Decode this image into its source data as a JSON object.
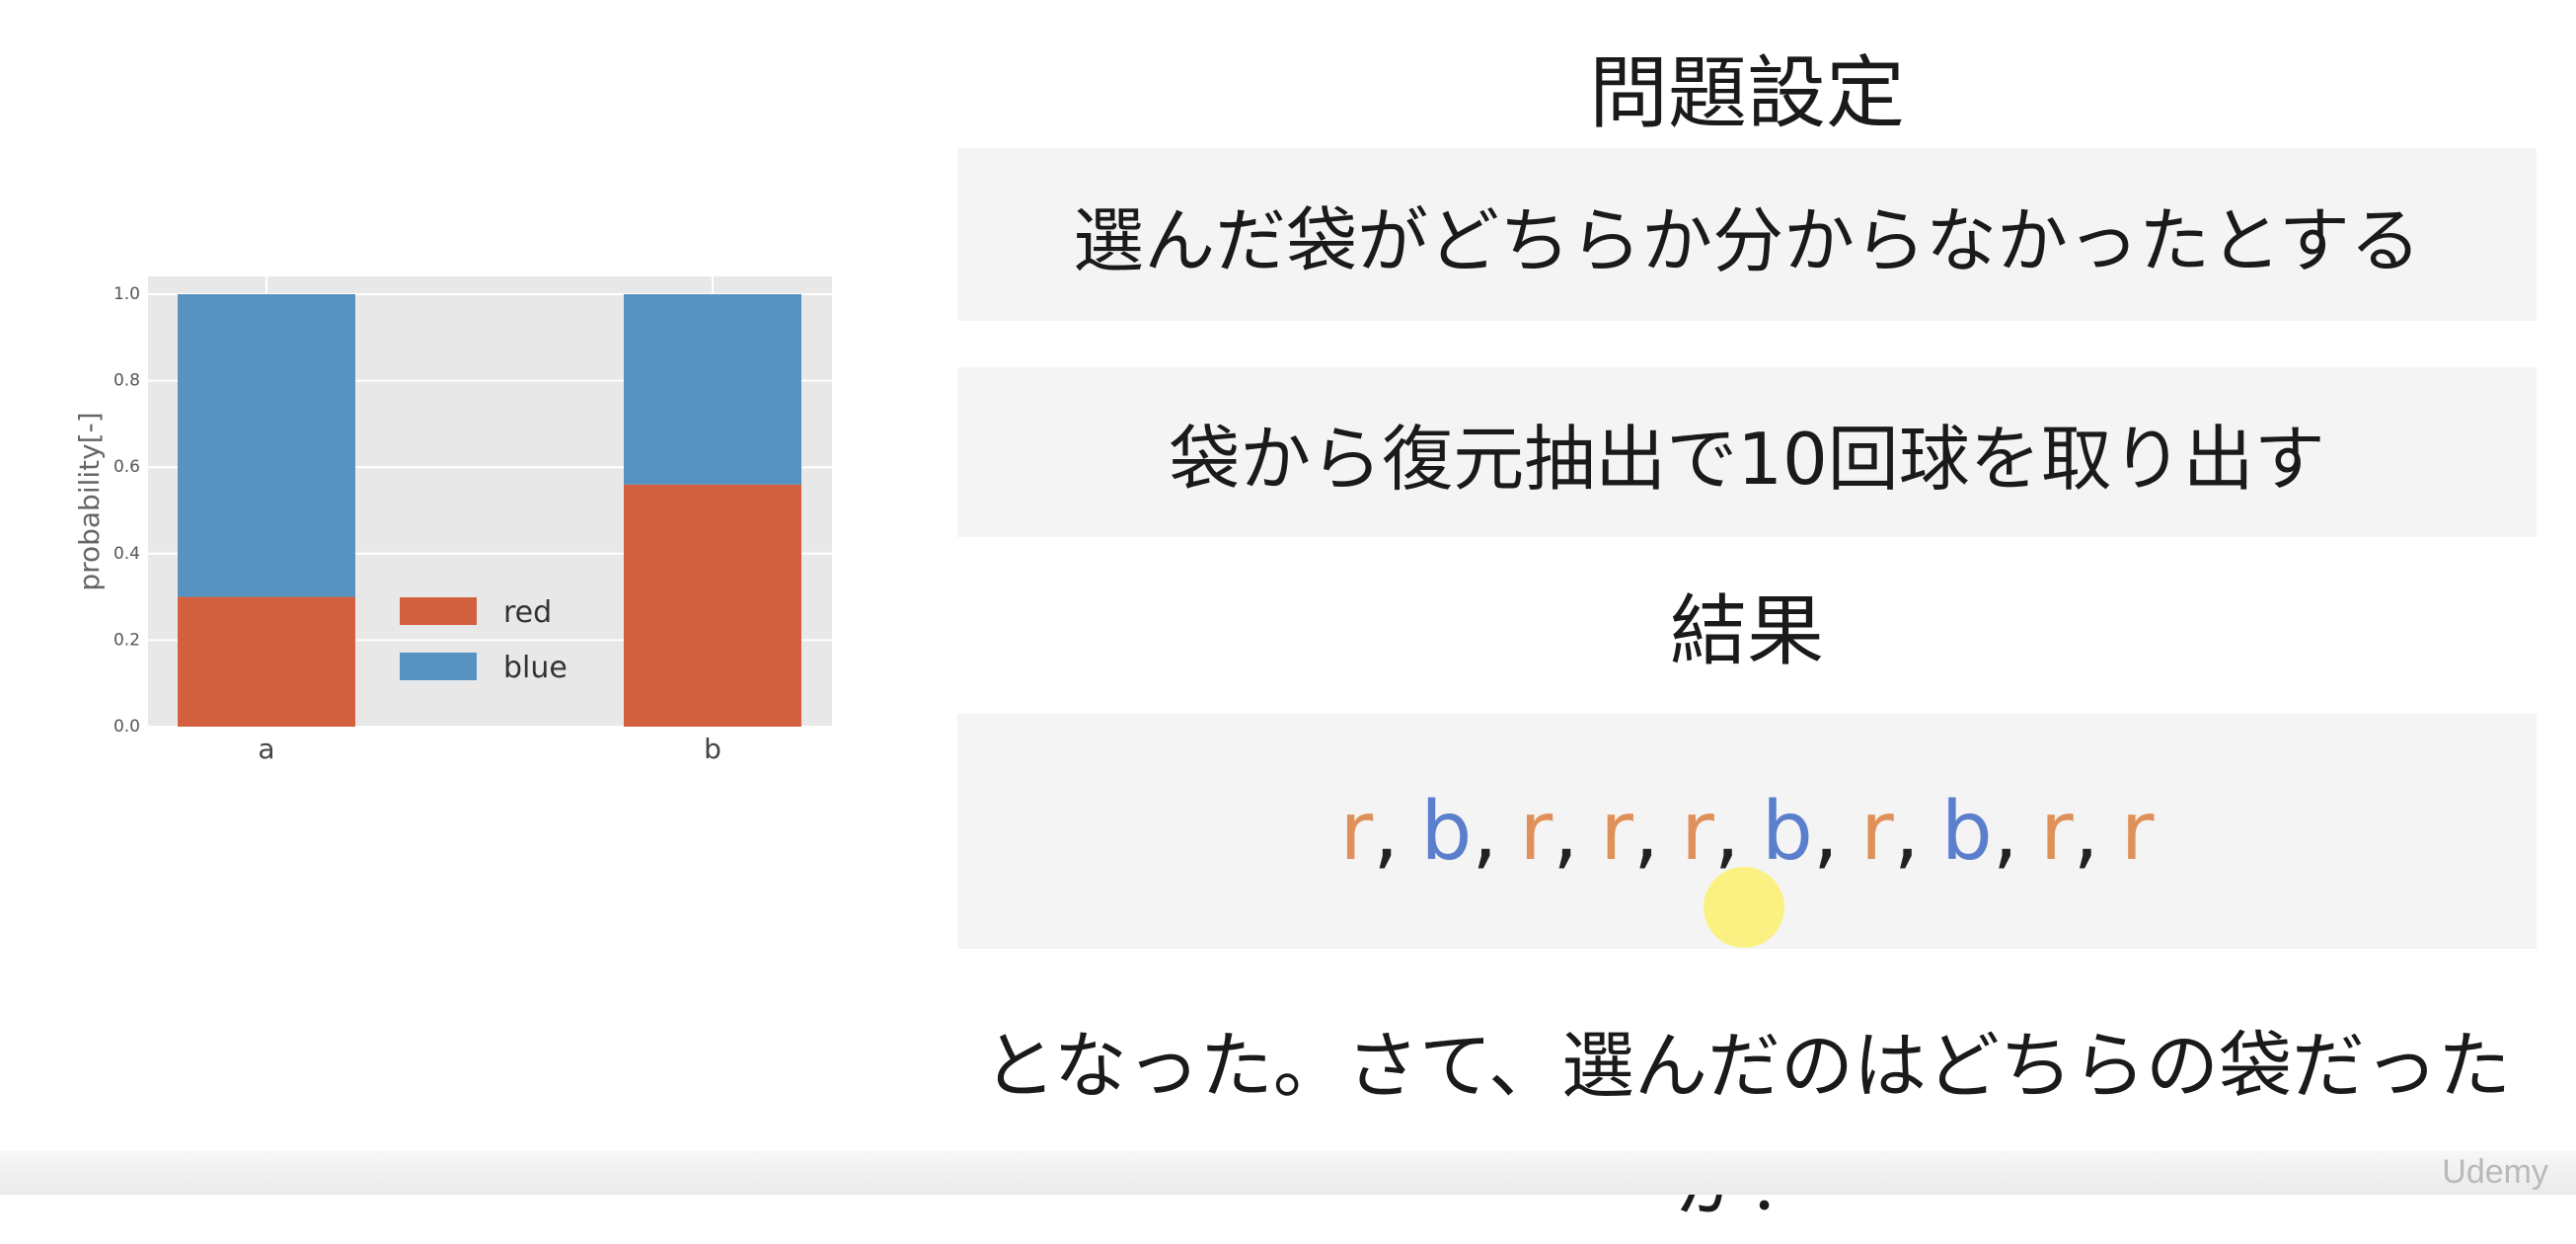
{
  "slide": {
    "title": "問題設定",
    "statement1": "選んだ袋がどちらか分からなかったとする",
    "statement2": "袋から復元抽出で10回球を取り出す",
    "result_heading": "結果",
    "sequence": [
      "r",
      "b",
      "r",
      "r",
      "r",
      "b",
      "r",
      "b",
      "r",
      "r"
    ],
    "separator": ",",
    "question": "となった。さて、選んだのはどちらの袋だったか？",
    "colors": {
      "r": "#e0915a",
      "b": "#5b7fcc"
    }
  },
  "watermark": "Udemy",
  "chart_data": {
    "type": "bar",
    "stacked": true,
    "categories": [
      "a",
      "b"
    ],
    "series": [
      {
        "name": "red",
        "values": [
          0.3,
          0.56
        ],
        "color": "#d3603f"
      },
      {
        "name": "blue",
        "values": [
          0.7,
          0.44
        ],
        "color": "#5792c1"
      }
    ],
    "ylabel": "probability[-]",
    "xlabel": "",
    "ylim": [
      0,
      1.0
    ],
    "yticks": [
      "0.0",
      "0.2",
      "0.4",
      "0.6",
      "0.8",
      "1.0"
    ],
    "grid": true,
    "legend_position": "center",
    "background": "#e8e8e8"
  }
}
